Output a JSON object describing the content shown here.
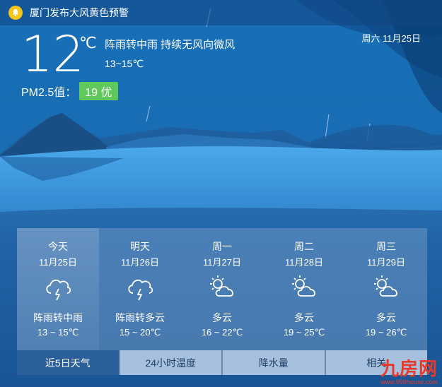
{
  "alert": {
    "text": "厦门发布大风黄色预警",
    "icon": "bell-icon"
  },
  "current": {
    "temp": "12",
    "unit": "℃",
    "description": "阵雨转中雨 持续无风向微风",
    "range": "13~15℃",
    "date": "周六 11月25日",
    "pm_label": "PM2.5值：",
    "pm_value": "19 优"
  },
  "forecast": [
    {
      "day": "今天",
      "date": "11月25日",
      "icon": "thunder-shower-icon",
      "desc": "阵雨转中雨",
      "temp": "13 ~ 15℃"
    },
    {
      "day": "明天",
      "date": "11月26日",
      "icon": "thunder-shower-icon",
      "desc": "阵雨转多云",
      "temp": "15 ~ 20℃"
    },
    {
      "day": "周一",
      "date": "11月27日",
      "icon": "partly-cloudy-icon",
      "desc": "多云",
      "temp": "16 ~ 22℃"
    },
    {
      "day": "周二",
      "date": "11月28日",
      "icon": "partly-cloudy-icon",
      "desc": "多云",
      "temp": "19 ~ 25℃"
    },
    {
      "day": "周三",
      "date": "11月29日",
      "icon": "partly-cloudy-icon",
      "desc": "多云",
      "temp": "19 ~ 26℃"
    }
  ],
  "tabs": [
    "近5日天气",
    "24小时温度",
    "降水量",
    "相关"
  ],
  "watermark": {
    "brand": "九房网",
    "url": "www.999house.com"
  },
  "colors": {
    "pm_good": "#5fc95b",
    "bell": "#f5c518",
    "watermark": "#e53a2c",
    "active_tab": "#2b5f9b"
  }
}
